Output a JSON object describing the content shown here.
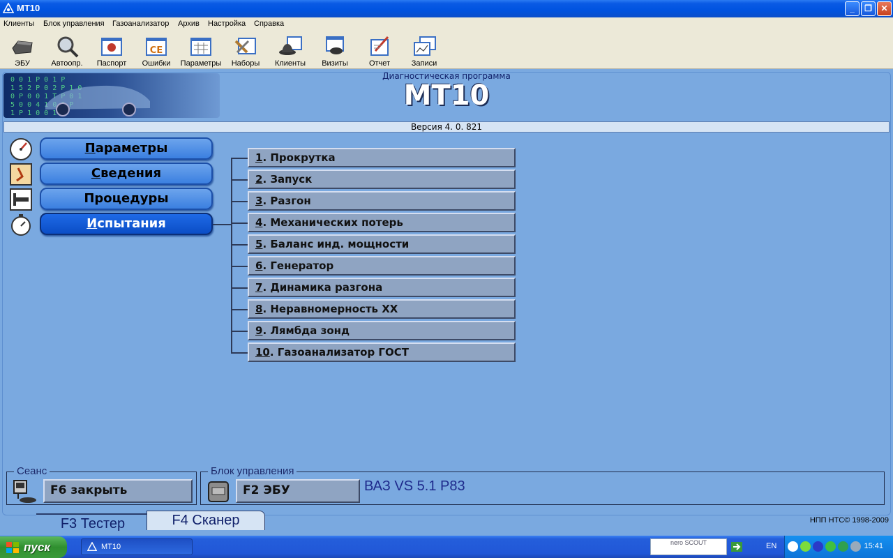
{
  "window": {
    "title": "MT10"
  },
  "menu": [
    "Клиенты",
    "Блок управления",
    "Газоанализатор",
    "Архив",
    "Настройка",
    "Справка"
  ],
  "toolbar": [
    {
      "label": "ЭБУ",
      "icon": "ecu-icon"
    },
    {
      "label": "Автоопр.",
      "icon": "magnifier-icon"
    },
    {
      "label": "Паспорт",
      "icon": "passport-icon"
    },
    {
      "label": "Ошибки",
      "icon": "errors-ce-icon"
    },
    {
      "label": "Параметры",
      "icon": "parameters-icon"
    },
    {
      "label": "Наборы",
      "icon": "tools-icon"
    },
    {
      "label": "Клиенты",
      "icon": "clients-icon"
    },
    {
      "label": "Визиты",
      "icon": "visits-icon"
    },
    {
      "label": "Отчет",
      "icon": "report-icon"
    },
    {
      "label": "Записи",
      "icon": "records-icon"
    }
  ],
  "banner": {
    "subtitle": "Диагностическая программа",
    "title": "МТ10",
    "version": "Версия  4. 0. 821"
  },
  "left_menu": [
    {
      "label": "Параметры",
      "accel": "П",
      "rest": "араметры",
      "icon": "gauge-icon",
      "active": false
    },
    {
      "label": "Сведения",
      "accel": "С",
      "rest": "ведения",
      "icon": "info-icon",
      "active": false
    },
    {
      "label": "Процедуры",
      "accel": "",
      "rest": "Процедуры",
      "icon": "procedure-icon",
      "active": false
    },
    {
      "label": "Испытания",
      "accel": "И",
      "rest": "спытания",
      "icon": "stopwatch-icon",
      "active": true
    }
  ],
  "tests": [
    {
      "num": "1",
      "label": ". Прокрутка"
    },
    {
      "num": "2",
      "label": ". Запуск"
    },
    {
      "num": "3",
      "label": ". Разгон"
    },
    {
      "num": "4",
      "label": ". Механических потерь"
    },
    {
      "num": "5",
      "label": ". Баланс инд. мощности"
    },
    {
      "num": "6",
      "label": ". Генератор"
    },
    {
      "num": "7",
      "label": ". Динамика разгона"
    },
    {
      "num": "8",
      "label": ". Неравномерность ХХ"
    },
    {
      "num": "9",
      "label": ". Лямбда зонд"
    },
    {
      "num": "10",
      "label": ". Газоанализатор ГОСТ"
    }
  ],
  "session": {
    "label": "Сеанс",
    "button": "F6 закрыть"
  },
  "ecu": {
    "label": "Блок управления",
    "button": "F2 ЭБУ",
    "name": "ВАЗ VS 5.1 P83"
  },
  "tabs": {
    "tester": "F3 Тестер",
    "scanner": "F4 Сканер"
  },
  "copyright": "НПП НТС© 1998-2009",
  "taskbar": {
    "start": "пуск",
    "task": "MT10",
    "nero": "nero SCOUT",
    "lang": "EN",
    "clock": "15:41"
  }
}
